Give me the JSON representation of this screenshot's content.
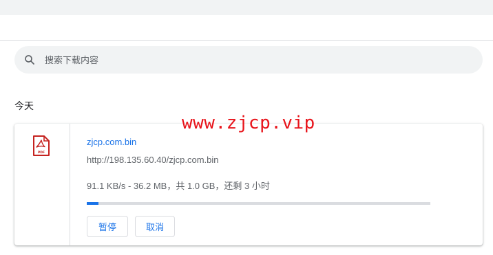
{
  "search": {
    "placeholder": "搜索下载内容",
    "icon": "search-icon"
  },
  "section": {
    "title": "今天"
  },
  "watermark": {
    "text": "www.zjcp.vip",
    "color": "#e8141b"
  },
  "download": {
    "file_icon": "pdf-file-icon",
    "file_name": "zjcp.com.bin",
    "url": "http://198.135.60.40/zjcp.com.bin",
    "status": "91.1 KB/s - 36.2 MB，共 1.0 GB，还剩 3 小时",
    "progress_fraction": 0.035,
    "pause_label": "暂停",
    "cancel_label": "取消"
  },
  "colors": {
    "accent": "#1a73e8",
    "pdf_red": "#c5221f",
    "search_bg": "#f1f3f4"
  }
}
